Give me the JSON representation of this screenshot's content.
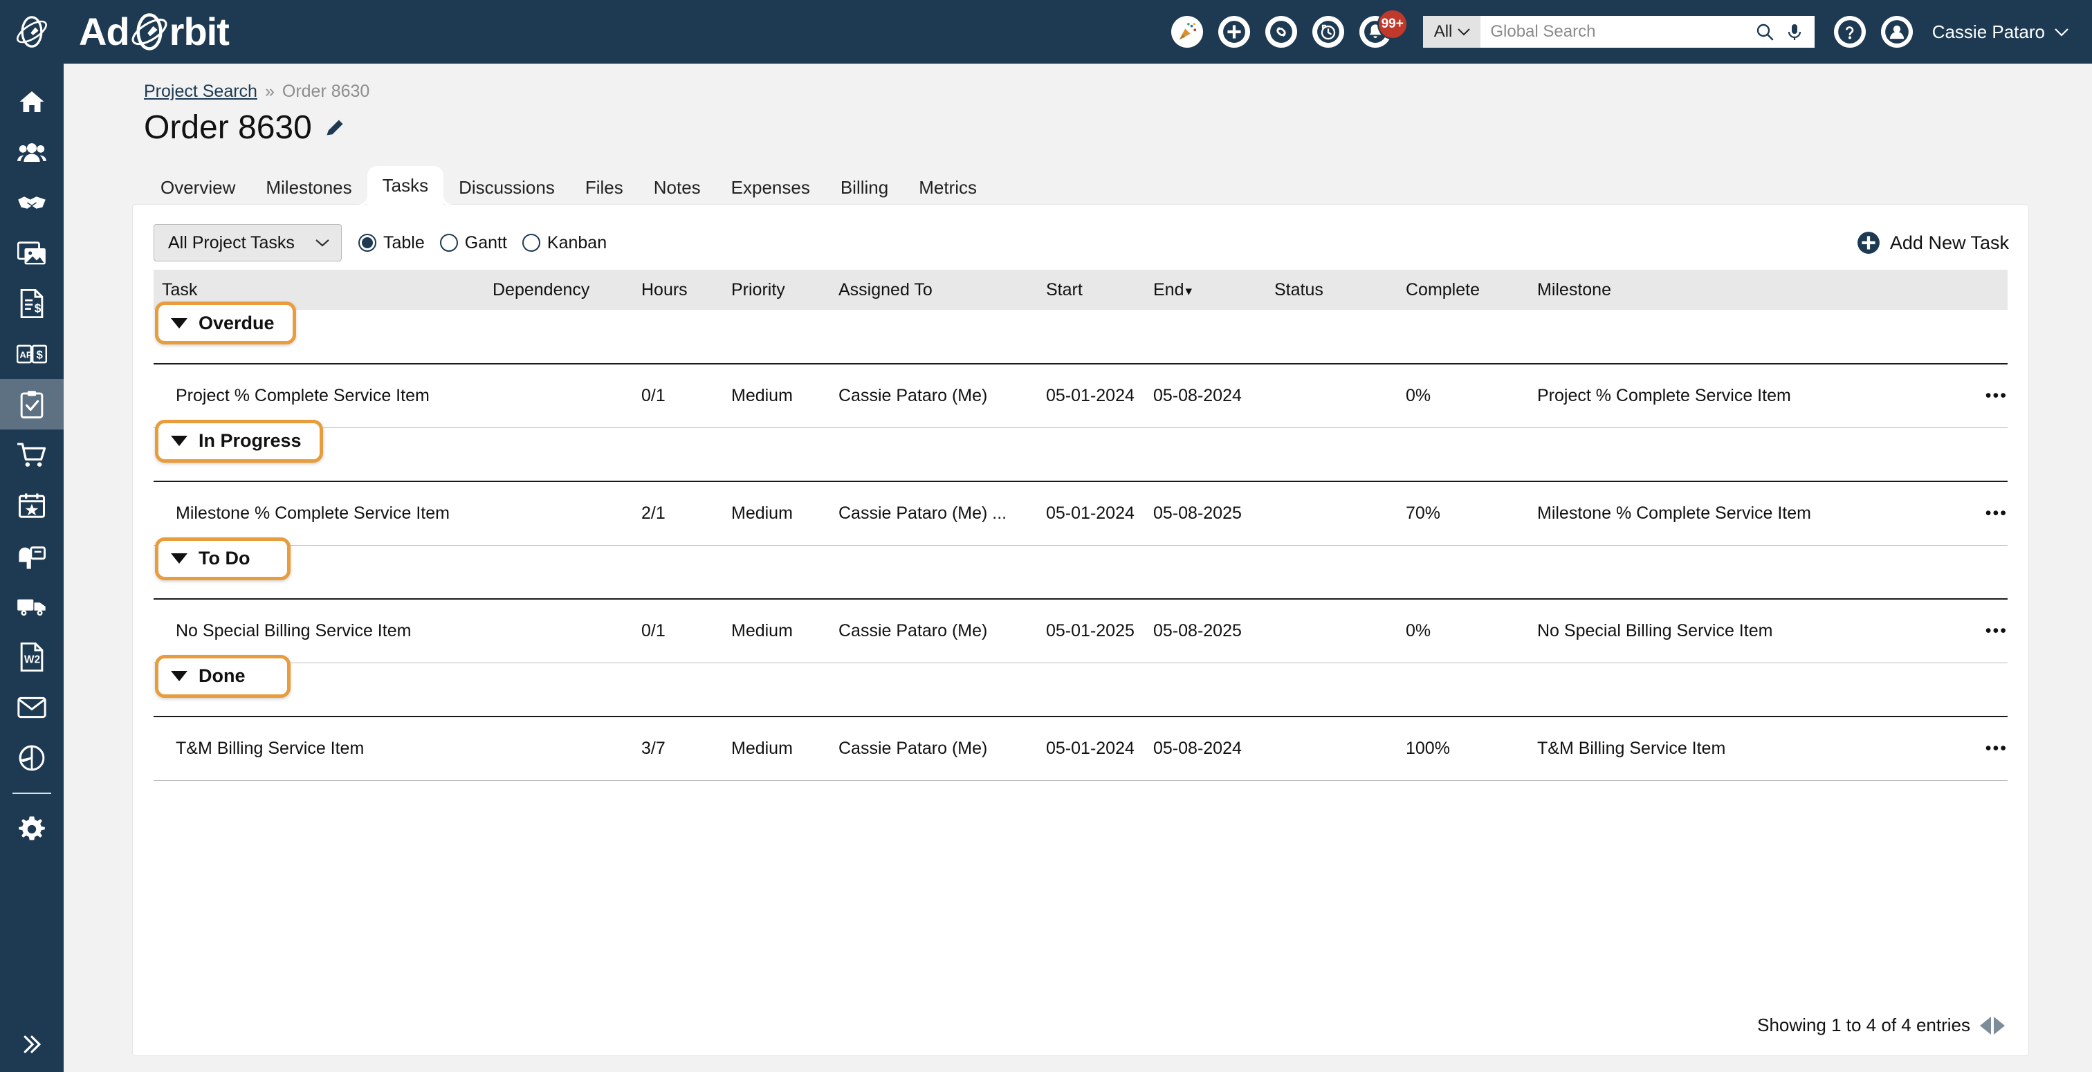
{
  "brand": {
    "name_pre": "Ad",
    "name_post": "rbit",
    "logo_icon": "orbit-satellite-icon"
  },
  "header": {
    "icons": [
      {
        "name": "party-popper-icon"
      },
      {
        "name": "plus-icon"
      },
      {
        "name": "link-icon"
      },
      {
        "name": "history-clock-icon"
      },
      {
        "name": "bell-icon",
        "badge": "99+"
      }
    ],
    "search": {
      "scope": "All",
      "placeholder": "Global Search",
      "value": ""
    },
    "help_icon": "question-mark-icon",
    "user": {
      "name": "Cassie Pataro",
      "avatar_icon": "user-avatar-icon"
    }
  },
  "sidebar": {
    "items": [
      {
        "name": "home-icon",
        "label": "Home",
        "active": false
      },
      {
        "name": "users-icon",
        "label": "Contacts",
        "active": false
      },
      {
        "name": "handshake-icon",
        "label": "Deals",
        "active": false
      },
      {
        "name": "images-icon",
        "label": "Media",
        "active": false
      },
      {
        "name": "invoice-dollar-icon",
        "label": "Invoices",
        "active": false
      },
      {
        "name": "ap-dollar-book-icon",
        "label": "Accounts Payable",
        "active": false
      },
      {
        "name": "clipboard-check-icon",
        "label": "Projects",
        "active": true
      },
      {
        "name": "shopping-cart-icon",
        "label": "Orders",
        "active": false
      },
      {
        "name": "calendar-star-icon",
        "label": "Calendar",
        "active": false
      },
      {
        "name": "mailbox-icon",
        "label": "Mailbox",
        "active": false
      },
      {
        "name": "truck-icon",
        "label": "Distribution",
        "active": false
      },
      {
        "name": "w2-document-icon",
        "label": "Payroll",
        "active": false
      },
      {
        "name": "envelope-icon",
        "label": "Email",
        "active": false
      },
      {
        "name": "pie-chart-icon",
        "label": "Reports",
        "active": false
      },
      {
        "name": "gear-icon",
        "label": "Settings",
        "active": false
      }
    ],
    "expand_icon": "chevron-double-right-icon"
  },
  "breadcrumb": {
    "link": "Project Search",
    "separator": "»",
    "current": "Order 8630"
  },
  "page": {
    "title": "Order 8630",
    "edit_icon": "pencil-icon"
  },
  "tabs": [
    {
      "label": "Overview",
      "active": false
    },
    {
      "label": "Milestones",
      "active": false
    },
    {
      "label": "Tasks",
      "active": true
    },
    {
      "label": "Discussions",
      "active": false
    },
    {
      "label": "Files",
      "active": false
    },
    {
      "label": "Notes",
      "active": false
    },
    {
      "label": "Expenses",
      "active": false
    },
    {
      "label": "Billing",
      "active": false
    },
    {
      "label": "Metrics",
      "active": false
    }
  ],
  "toolbar": {
    "filter_select": "All Project Tasks",
    "views": [
      {
        "label": "Table",
        "selected": true
      },
      {
        "label": "Gantt",
        "selected": false
      },
      {
        "label": "Kanban",
        "selected": false
      }
    ],
    "add_button": "Add New Task",
    "add_icon": "plus-circle-icon"
  },
  "table": {
    "columns": [
      {
        "key": "task",
        "label": "Task"
      },
      {
        "key": "dependency",
        "label": "Dependency"
      },
      {
        "key": "hours",
        "label": "Hours"
      },
      {
        "key": "priority",
        "label": "Priority"
      },
      {
        "key": "assigned",
        "label": "Assigned To"
      },
      {
        "key": "start",
        "label": "Start"
      },
      {
        "key": "end",
        "label": "End",
        "sorted": "desc",
        "sort_caret": "▾"
      },
      {
        "key": "status",
        "label": "Status"
      },
      {
        "key": "complete",
        "label": "Complete"
      },
      {
        "key": "milestone",
        "label": "Milestone"
      },
      {
        "key": "actions",
        "label": ""
      }
    ],
    "groups": [
      {
        "label": "Overdue",
        "expanded": true,
        "rows": [
          {
            "task": "Project % Complete Service Item",
            "dependency": "",
            "hours": "0/1",
            "priority": "Medium",
            "assigned": "Cassie Pataro (Me)",
            "start": "05-01-2024",
            "end": "05-08-2024",
            "status": "",
            "complete": "0%",
            "milestone": "Project % Complete Service Item",
            "actions": "•••"
          }
        ]
      },
      {
        "label": "In Progress",
        "expanded": true,
        "rows": [
          {
            "task": "Milestone % Complete Service Item",
            "dependency": "",
            "hours": "2/1",
            "priority": "Medium",
            "assigned": "Cassie Pataro (Me) ...",
            "start": "05-01-2024",
            "end": "05-08-2025",
            "status": "",
            "complete": "70%",
            "milestone": "Milestone % Complete Service Item",
            "actions": "•••"
          }
        ]
      },
      {
        "label": "To Do",
        "expanded": true,
        "rows": [
          {
            "task": "No Special Billing Service Item",
            "dependency": "",
            "hours": "0/1",
            "priority": "Medium",
            "assigned": "Cassie Pataro (Me)",
            "start": "05-01-2025",
            "end": "05-08-2025",
            "status": "",
            "complete": "0%",
            "milestone": "No Special Billing Service Item",
            "actions": "•••"
          }
        ]
      },
      {
        "label": "Done",
        "expanded": true,
        "rows": [
          {
            "task": "T&M Billing Service Item",
            "dependency": "",
            "hours": "3/7",
            "priority": "Medium",
            "assigned": "Cassie Pataro (Me)",
            "start": "05-01-2024",
            "end": "05-08-2024",
            "status": "",
            "complete": "100%",
            "milestone": "T&M Billing Service Item",
            "actions": "•••"
          }
        ]
      }
    ],
    "footer": {
      "entries_text": "Showing 1 to 4 of 4 entries"
    }
  },
  "colors": {
    "navy": "#1d3a52",
    "highlight_orange": "#e89c3c",
    "page_bg": "#f2f2f2",
    "badge_red": "#c0392b",
    "active_sidebar": "#5d7182"
  }
}
